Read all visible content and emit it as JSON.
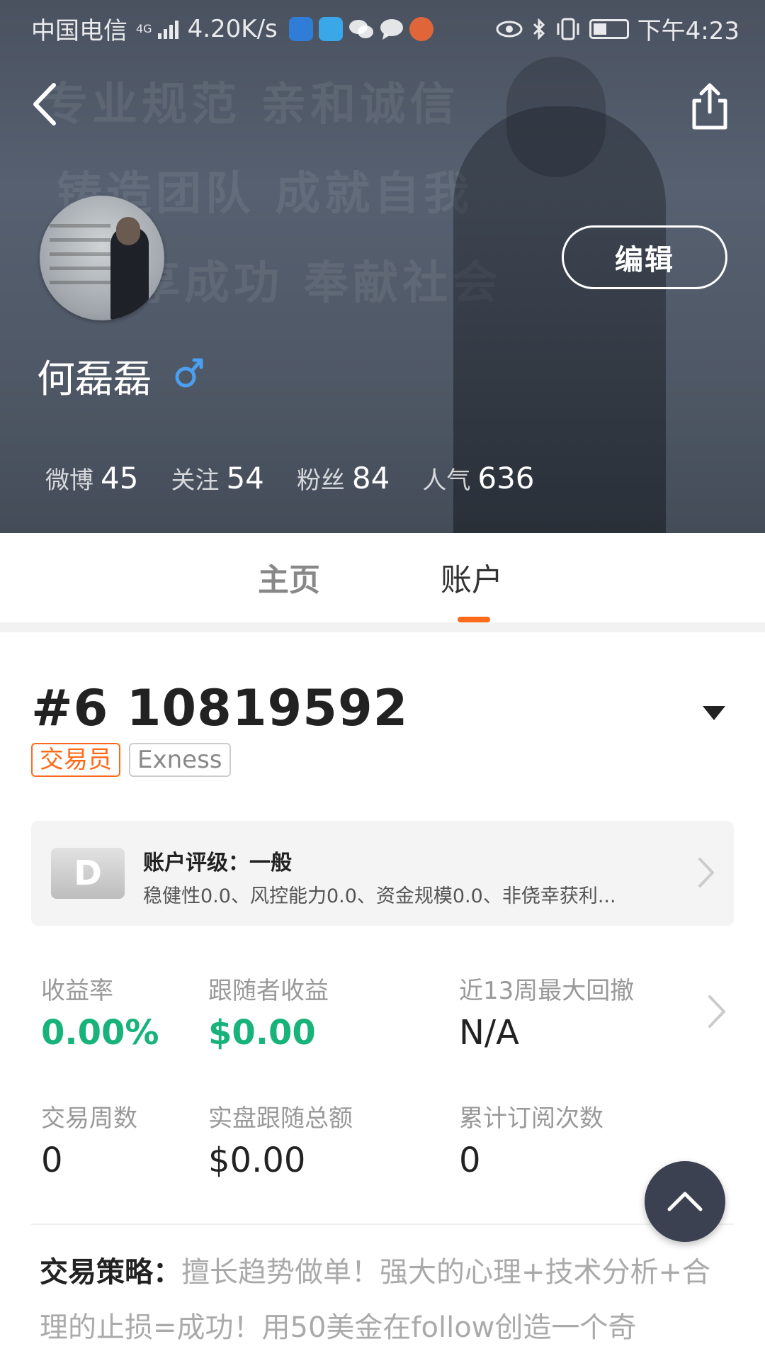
{
  "status_bar": {
    "carrier": "中国电信",
    "network": "4G",
    "speed": "4.20K/s",
    "time": "下午4:23"
  },
  "profile": {
    "name": "何磊磊",
    "gender_symbol": "♂",
    "edit_label": "编辑",
    "background_slogans": [
      "专业规范 亲和诚信",
      "铸造团队 成就自我",
      "分享成功 奉献社会"
    ],
    "stats": [
      {
        "label": "微博",
        "value": "45"
      },
      {
        "label": "关注",
        "value": "54"
      },
      {
        "label": "粉丝",
        "value": "84"
      },
      {
        "label": "人气",
        "value": "636"
      }
    ]
  },
  "tabs": [
    {
      "label": "主页",
      "active": false
    },
    {
      "label": "账户",
      "active": true
    }
  ],
  "account": {
    "number": "#6 10819592",
    "tags": [
      "交易员",
      "Exness"
    ],
    "rating": {
      "grade": "D",
      "title": "账户评级：一般",
      "description": "稳健性0.0、风控能力0.0、资金规模0.0、非侥幸获利..."
    },
    "metrics_row1": [
      {
        "label": "收益率",
        "value": "0.00%"
      },
      {
        "label": "跟随者收益",
        "value": "$0.00"
      },
      {
        "label": "近13周最大回撤",
        "value": "N/A"
      }
    ],
    "metrics_row2": [
      {
        "label": "交易周数",
        "value": "0"
      },
      {
        "label": "实盘跟随总额",
        "value": "$0.00"
      },
      {
        "label": "累计订阅次数",
        "value": "0"
      }
    ],
    "strategy_label": "交易策略：",
    "strategy_text": "擅长趋势做单！强大的心理+技术分析+合理的止损=成功！用50美金在follow创造一个奇"
  },
  "colors": {
    "accent": "#ff6a1a",
    "positive": "#17b37b",
    "fab": "#3b4150"
  },
  "icons": {
    "back": "back-arrow-icon",
    "share": "share-icon",
    "dropdown": "dropdown-triangle-icon",
    "chevron": "chevron-right-icon",
    "fab": "arrow-up-icon"
  }
}
